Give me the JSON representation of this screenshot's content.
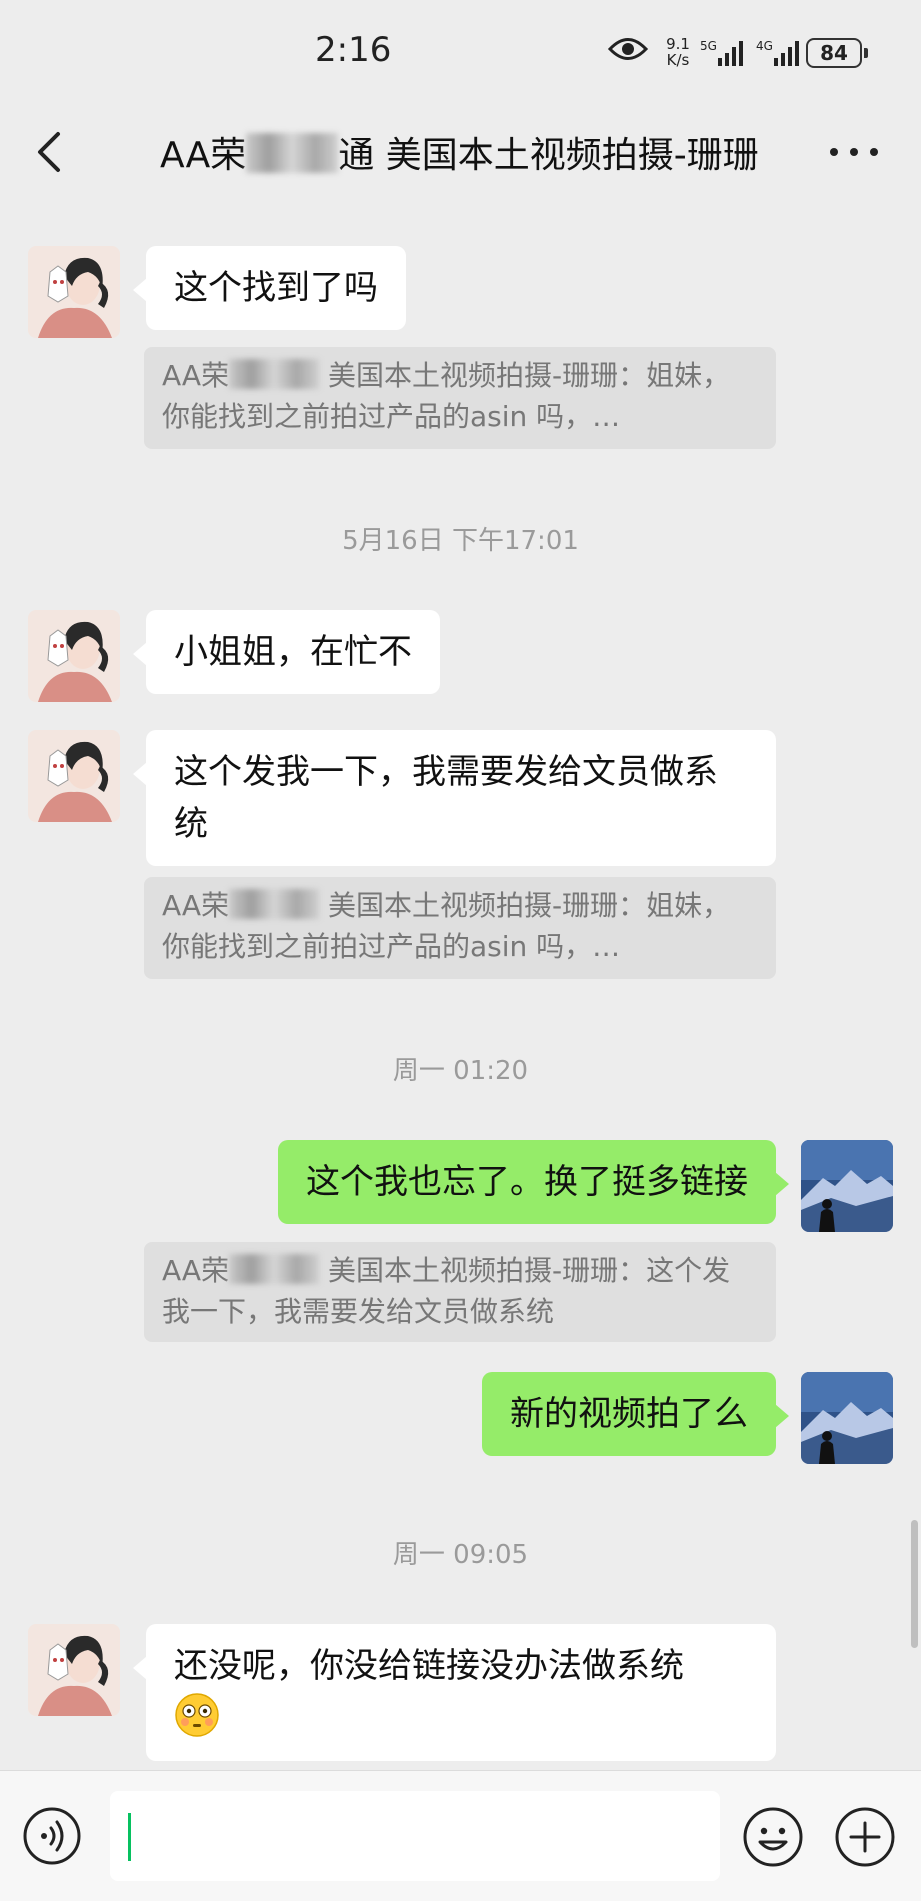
{
  "status_bar": {
    "time": "2:16",
    "net_speed_value": "9.1",
    "net_speed_unit": "K/s",
    "signal_1_label": "5G",
    "signal_2_label": "4G",
    "battery": "84"
  },
  "header": {
    "title_prefix": "AA荣",
    "title_mid": "通",
    "title_rest": " 美国本土视频拍摄-珊珊"
  },
  "messages": [
    {
      "text": "这个找到了吗"
    },
    {
      "quote_prefix": "AA荣",
      "quote_text": " 美国本土视频拍摄-珊珊：姐妹，你能找到之前拍过产品的asin 吗，…"
    },
    {
      "timestamp": "5月16日 下午17:01"
    },
    {
      "text": "小姐姐，在忙不"
    },
    {
      "text": "这个发我一下，我需要发给文员做系统"
    },
    {
      "quote_prefix": "AA荣",
      "quote_text": " 美国本土视频拍摄-珊珊：姐妹，你能找到之前拍过产品的asin 吗，…"
    },
    {
      "timestamp": "周一 01:20"
    },
    {
      "text": "这个我也忘了。换了挺多链接"
    },
    {
      "quote_prefix": "AA荣",
      "quote_text": " 美国本土视频拍摄-珊珊：这个发我一下，我需要发给文员做系统"
    },
    {
      "text": "新的视频拍了么"
    },
    {
      "timestamp": "周一 09:05"
    },
    {
      "text": "还没呢，你没给链接没办法做系统"
    }
  ],
  "colors": {
    "background": "#ededed",
    "sent_bubble": "#95ec69",
    "received_bubble": "#ffffff",
    "quote_bg": "#dfdfdf",
    "cursor": "#07c160"
  },
  "icons": [
    "back-arrow-icon",
    "more-dots-icon",
    "eye-icon",
    "signal-icon",
    "battery-icon",
    "voice-icon",
    "emoji-icon",
    "plus-icon",
    "flushed-face-emoji"
  ]
}
